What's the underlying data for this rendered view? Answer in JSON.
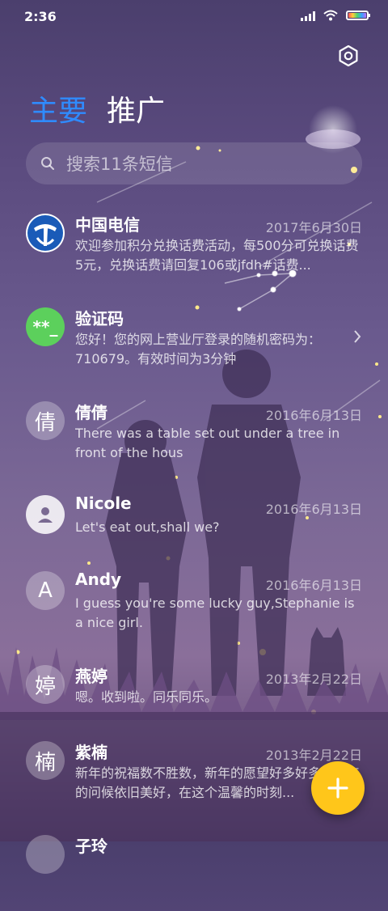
{
  "status_bar": {
    "time": "2:36",
    "icons": [
      "signal-icon",
      "wifi-icon",
      "battery-icon"
    ]
  },
  "header": {
    "settings_icon": "gear-icon",
    "tabs": [
      {
        "label": "主要",
        "active": true,
        "color": "#2f8bff"
      },
      {
        "label": "推广",
        "active": false
      }
    ]
  },
  "search": {
    "icon": "search-icon",
    "placeholder": "搜索11条短信"
  },
  "messages": [
    {
      "name": "中国电信",
      "date": "2017年6月30日",
      "preview": "欢迎参加积分兑换话费活动，每500分可兑换话费5元，兑换话费请回复106或jfdh#话费...",
      "avatar": "china-telecom-logo"
    },
    {
      "name": "验证码",
      "date": "",
      "preview": "您好！您的网上营业厅登录的随机密码为：710679。有效时间为3分钟",
      "avatar_text": "**_",
      "avatar_color": "#5cd05c"
    },
    {
      "name": "倩倩",
      "date": "2016年6月13日",
      "preview": "There was a table set out under a tree in front of the hous",
      "avatar_text": "倩"
    },
    {
      "name": "Nicole",
      "date": "2016年6月13日",
      "preview": "Let's eat out,shall we?",
      "avatar": "person-icon"
    },
    {
      "name": "Andy",
      "date": "2016年6月13日",
      "preview": "I guess you're some lucky guy,Stephanie is a nice girl.",
      "avatar_text": "A"
    },
    {
      "name": "燕婷",
      "date": "2013年2月22日",
      "preview": "嗯。收到啦。同乐同乐。",
      "avatar_text": "婷"
    },
    {
      "name": "紫楠",
      "date": "2013年2月22日",
      "preview": "新年的祝福数不胜数，新年的愿望好多好多，新年的问候依旧美好，在这个温馨的时刻...",
      "avatar_text": "楠"
    },
    {
      "name": "子玲",
      "date": "",
      "preview": "",
      "avatar_text": ""
    }
  ],
  "fab": {
    "icon": "plus-icon",
    "color": "#ffc61a"
  }
}
